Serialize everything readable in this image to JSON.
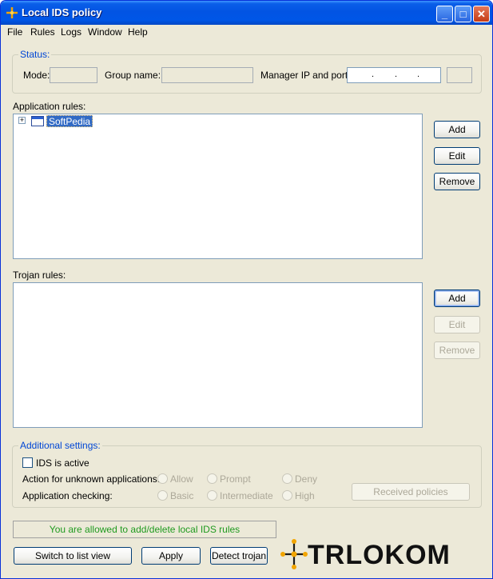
{
  "window": {
    "title": "Local IDS policy",
    "controls": {
      "minimize": "_",
      "maximize": "□",
      "close": "✕"
    }
  },
  "menu": [
    "File",
    "Rules",
    "Logs",
    "Window",
    "Help"
  ],
  "status": {
    "group_label": "Status:",
    "mode_label": "Mode:",
    "group_name_label": "Group name:",
    "manager_label": "Manager IP and port:",
    "ip_dots": [
      ".",
      ".",
      "."
    ]
  },
  "application_rules": {
    "label": "Application rules:",
    "tree": [
      {
        "expander": "+",
        "label": "SoftPedia"
      }
    ],
    "buttons": {
      "add": "Add",
      "edit": "Edit",
      "remove": "Remove"
    }
  },
  "trojan_rules": {
    "label": "Trojan rules:",
    "buttons": {
      "add": "Add",
      "edit": "Edit",
      "remove": "Remove"
    }
  },
  "additional": {
    "group_label": "Additional settings:",
    "ids_active_label": "IDS is active",
    "unknown_label": "Action for unknown applications:",
    "unknown_options": [
      "Allow",
      "Prompt",
      "Deny"
    ],
    "checking_label": "Application checking:",
    "checking_options": [
      "Basic",
      "Intermediate",
      "High"
    ],
    "received_policies": "Received policies"
  },
  "status_message": "You are allowed to add/delete local IDS rules",
  "bottom_buttons": {
    "switch": "Switch to list view",
    "apply": "Apply",
    "detect": "Detect trojan"
  },
  "logo_text": "TRLOKOM",
  "colors": {
    "title_bar": "#0254e3",
    "group_label": "#0046d5",
    "status_message": "#1f9a1f",
    "selection": "#316ac5"
  }
}
